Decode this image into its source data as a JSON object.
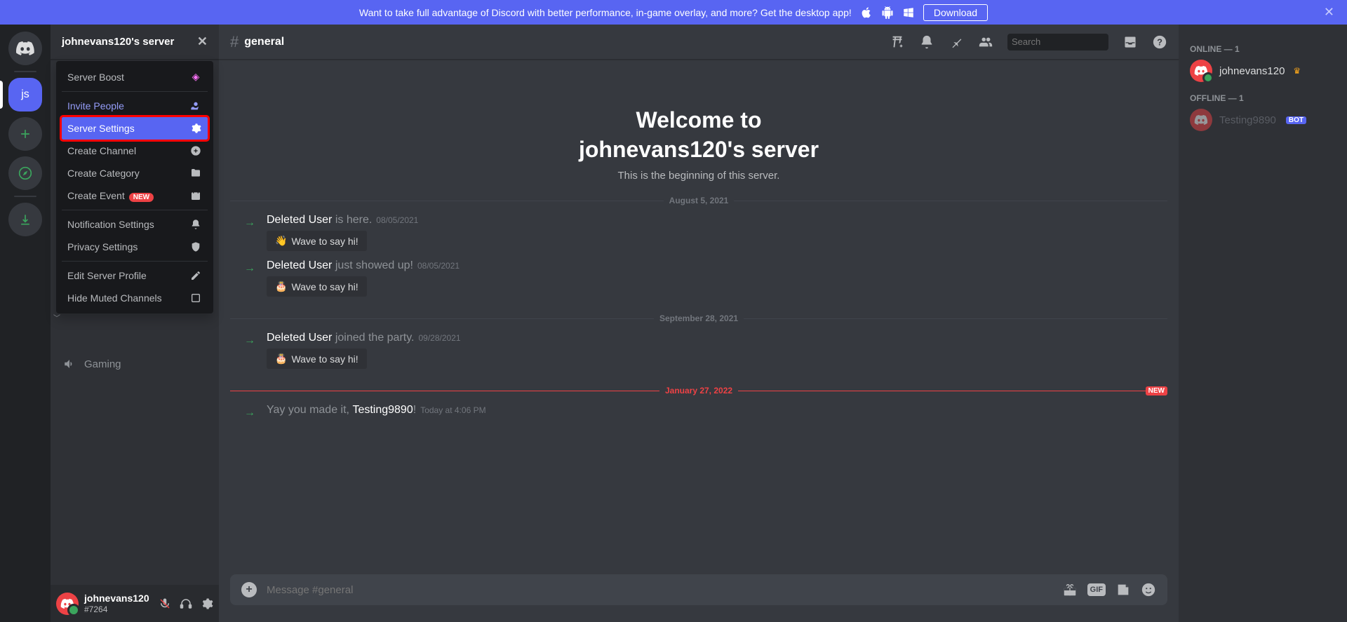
{
  "promo": {
    "text": "Want to take full advantage of Discord with better performance, in-game overlay, and more? Get the desktop app!",
    "download": "Download"
  },
  "serverList": {
    "active_initials": "js"
  },
  "sidebar": {
    "server_name": "johnevans120's server",
    "peek_channel": "Gaming"
  },
  "dropdown": {
    "items": [
      {
        "label": "Server Boost",
        "icon": "boost"
      },
      {
        "label": "Invite People",
        "icon": "invite",
        "style": "invite"
      },
      {
        "label": "Server Settings",
        "icon": "gear",
        "style": "highlight"
      },
      {
        "label": "Create Channel",
        "icon": "plus-circle"
      },
      {
        "label": "Create Category",
        "icon": "folder-plus"
      },
      {
        "label": "Create Event",
        "icon": "calendar",
        "badge": "NEW"
      },
      {
        "label": "Notification Settings",
        "icon": "bell"
      },
      {
        "label": "Privacy Settings",
        "icon": "shield"
      },
      {
        "label": "Edit Server Profile",
        "icon": "pencil"
      },
      {
        "label": "Hide Muted Channels",
        "icon": "checkbox"
      }
    ]
  },
  "userPanel": {
    "name": "johnevans120",
    "tag": "#7264"
  },
  "chat": {
    "channel": "general",
    "welcome_title_1": "Welcome to",
    "welcome_title_2": "johnevans120's server",
    "welcome_sub": "This is the beginning of this server.",
    "composer_placeholder": "Message #general",
    "search_placeholder": "Search",
    "dates": {
      "d1": "August 5, 2021",
      "d2": "September 28, 2021",
      "d3": "January 27, 2022",
      "new_tag": "NEW"
    },
    "messages": [
      {
        "user": "Deleted User",
        "text": " is here.",
        "ts": "08/05/2021",
        "wave": "Wave to say hi!",
        "emoji": "👋"
      },
      {
        "user": "Deleted User",
        "text": " just showed up!",
        "ts": "08/05/2021",
        "wave": "Wave to say hi!",
        "emoji": "🎂"
      },
      {
        "user": "Deleted User",
        "text": " joined the party.",
        "ts": "09/28/2021",
        "wave": "Wave to say hi!",
        "emoji": "🎂"
      },
      {
        "prefix": "Yay you made it, ",
        "user": "Testing9890",
        "suffix": "!",
        "ts": "Today at 4:06 PM"
      }
    ]
  },
  "members": {
    "online_header": "ONLINE — 1",
    "offline_header": "OFFLINE — 1",
    "online": [
      {
        "name": "johnevans120",
        "owner": true
      }
    ],
    "offline": [
      {
        "name": "Testing9890",
        "bot": true
      }
    ],
    "bot_label": "BOT"
  }
}
